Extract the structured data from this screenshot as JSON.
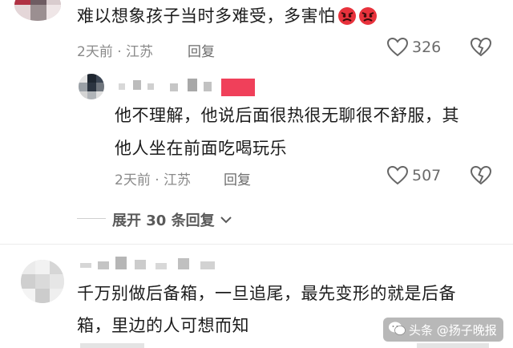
{
  "comments": [
    {
      "text": "难以想象孩子当时多难受，多害怕",
      "emojis": [
        "angry-face-emoji",
        "angry-face-emoji"
      ],
      "meta": "2天前 · 江苏",
      "reply_label": "回复",
      "likes": "326"
    },
    {
      "text_line1": "他不理解，他说后面很热很无聊很不舒服，其",
      "text_line2": "他人坐在前面吃喝玩乐",
      "meta": "2天前 · 江苏",
      "reply_label": "回复",
      "likes": "507"
    },
    {
      "text_line1": "千万别做后备箱，一旦追尾，最先变形的就是后备",
      "text_line2": "箱，里边的人可想而知"
    }
  ],
  "expand_replies": "展开 30 条回复",
  "watermark": "头条 @扬子晚报",
  "colors": {
    "accent_red": "#f0405a",
    "muted": "#8a8a8a"
  }
}
